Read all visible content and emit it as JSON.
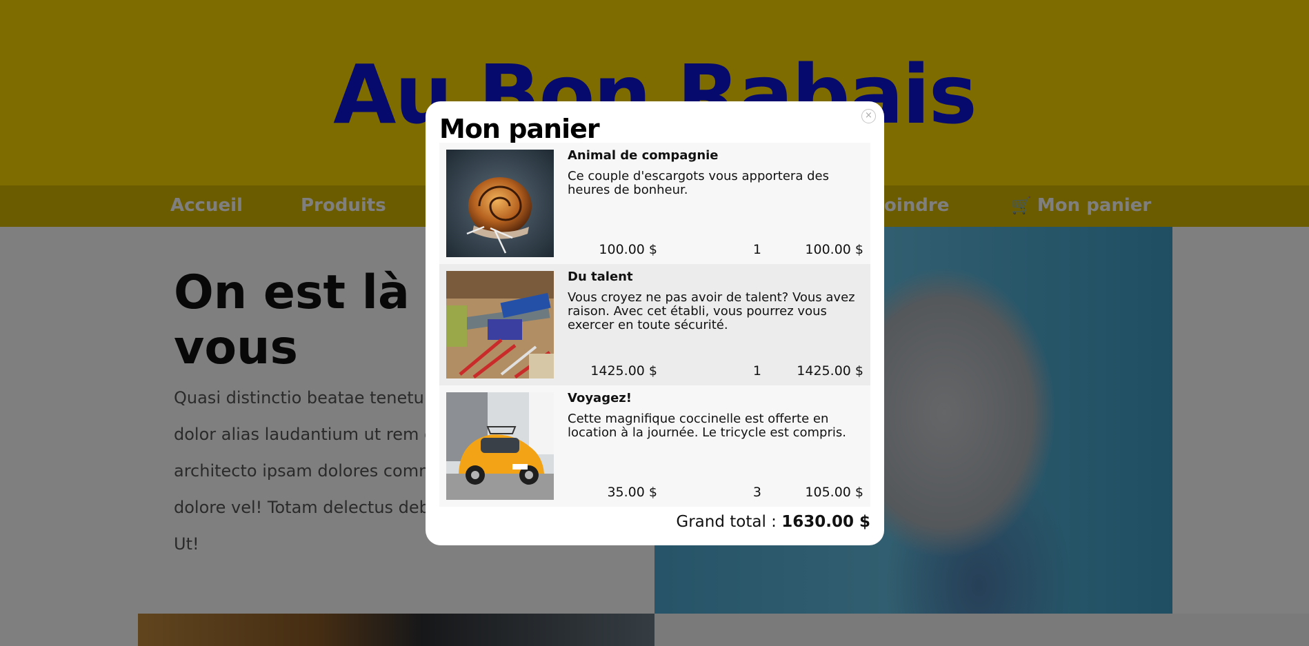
{
  "site": {
    "title": "Au Bon Rabais",
    "nav": [
      {
        "label": "Accueil"
      },
      {
        "label": "Produits"
      },
      {
        "label": "oindre"
      },
      {
        "label": "Mon panier"
      }
    ],
    "hero_title": "On est là p\nvous",
    "hero_text": "Quasi distinctio beatae tenetur n\ndolor alias laudantium ut rem qu\narchitecto ipsam dolores commo\ndolore vel! Totam delectus debiti\nUt!"
  },
  "cart": {
    "title": "Mon panier",
    "close_icon": "×",
    "items": [
      {
        "name": "Animal de compagnie",
        "description": "Ce couple d'escargots vous apportera des heures de bonheur.",
        "price": "100.00 $",
        "quantity": "1",
        "total": "100.00 $",
        "image": "snail-photo"
      },
      {
        "name": "Du talent",
        "description": "Vous croyez ne pas avoir de talent? Vous avez raison. Avec cet établi, vous pourrez vous exercer en toute sécurité.",
        "price": "1425.00 $",
        "quantity": "1",
        "total": "1425.00 $",
        "image": "tools-photo"
      },
      {
        "name": "Voyagez!",
        "description": "Cette magnifique coccinelle est offerte en location à la journée. Le tricycle est compris.",
        "price": "35.00 $",
        "quantity": "3",
        "total": "105.00 $",
        "image": "yellow-beetle-photo"
      }
    ],
    "grand_total_label": "Grand total : ",
    "grand_total_value": "1630.00 $"
  },
  "colors": {
    "header_yellow": "#ffd900",
    "title_blue": "#0a14d8",
    "nav_bar": "#d8b800"
  }
}
